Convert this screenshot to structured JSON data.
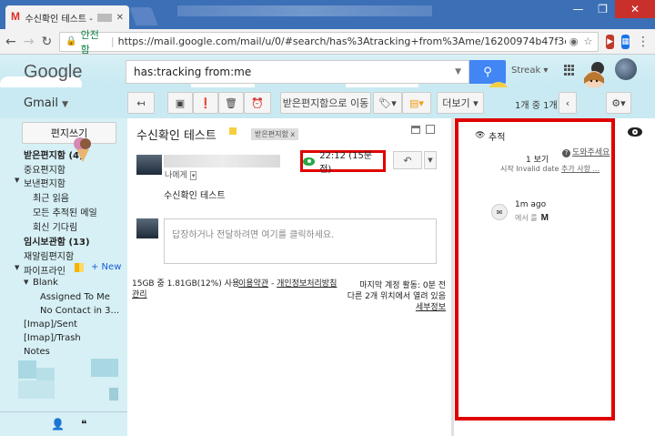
{
  "browser": {
    "tab_title": "수신확인 테스트 -",
    "tab_close": "✕",
    "window_min": "—",
    "window_max": "❐",
    "window_close": "✕",
    "secure_label": "안전함",
    "url": "https://mail.google.com/mail/u/0/#search/has%3Atracking+from%3Ame/16200974b47f3e67"
  },
  "header": {
    "logo": "Google",
    "search_value": "has:tracking from:me",
    "streak_label": "Streak ▾"
  },
  "toolbar": {
    "gmail_label": "Gmail",
    "move_to_inbox": "받은편지함으로 이동",
    "more_label": "더보기",
    "page_info": "1개 중 1개"
  },
  "sidebar": {
    "compose": "편지쓰기",
    "items": [
      {
        "label": "받은편지함 (4)",
        "bold": true
      },
      {
        "label": "중요편지함"
      },
      {
        "label": "보낸편지함"
      },
      {
        "label": "최근 읽음"
      },
      {
        "label": "모든 추적된 메일"
      },
      {
        "label": "회신 기다림"
      },
      {
        "label": "임시보관함 (13)",
        "bold": true
      },
      {
        "label": "재알림편지함"
      },
      {
        "label": "파이프라인"
      },
      {
        "label": "Blank"
      },
      {
        "label": "Assigned To Me"
      },
      {
        "label": "No Contact in 3..."
      },
      {
        "label": "[Imap]/Sent"
      },
      {
        "label": "[Imap]/Trash"
      },
      {
        "label": "Notes"
      }
    ],
    "new_link": "+ New"
  },
  "message": {
    "subject": "수신확인 테스트",
    "inbox_chip": "받은편지함 x",
    "to_me": "나에게",
    "tracking_time": "22:12 (15분 전)",
    "body": "수신확인 테스트",
    "reply_placeholder": "답장하거나 전달하려면 여기를 클릭하세요.",
    "storage": "15GB 중 1.81GB(12%) 사용",
    "manage": "관리",
    "terms": "이용약관",
    "privacy": "개인정보처리방침",
    "activity_line1": "마지막 계정 활동: 0분 전",
    "activity_line2": "다른 2개 위치에서 열려 있음",
    "details": "세부정보"
  },
  "tracking_panel": {
    "title": "추적",
    "help": "도와주세요",
    "views": "1 보기",
    "start_prefix": "시작 Invalid date",
    "start_link": "추가 사항 ...",
    "event_time": "1m ago",
    "event_from": "에서 를",
    "event_mark": "M"
  }
}
